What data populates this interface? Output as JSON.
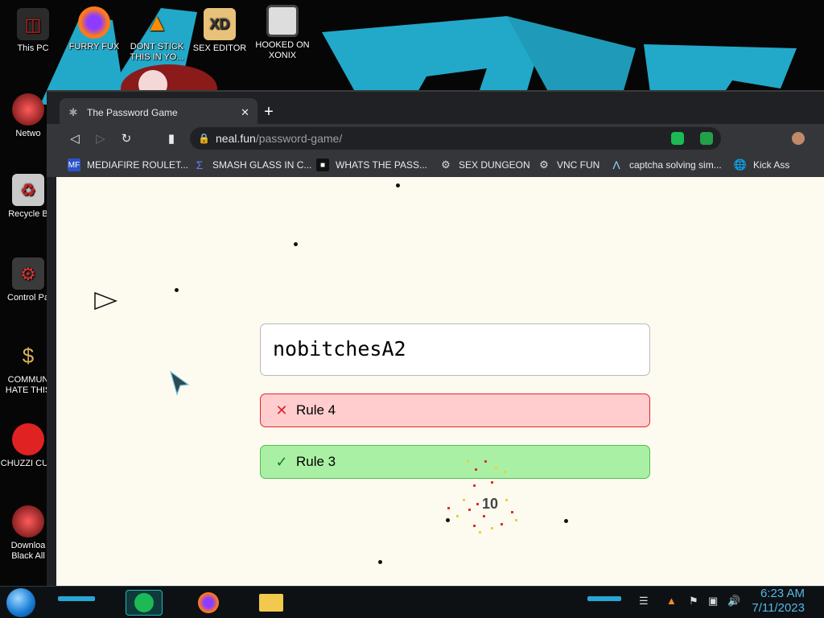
{
  "desktop": {
    "top_icons": [
      {
        "label": "This PC",
        "icon": "computer-icon"
      },
      {
        "label": "FURRY FUX",
        "icon": "firefox-icon"
      },
      {
        "label": "DONT STICK THIS IN YO...",
        "icon": "vlc-cone-icon"
      },
      {
        "label": "SEX EDITOR",
        "icon": "xd-editor-icon"
      },
      {
        "label": "HOOKED ON XONIX",
        "icon": "xonix-game-icon"
      }
    ],
    "left_icons": [
      {
        "label": "Netwo",
        "icon": "network-icon"
      },
      {
        "label": "Recycle B",
        "icon": "recycle-bin-icon"
      },
      {
        "label": "Control Pa",
        "icon": "control-panel-icon"
      },
      {
        "label": "COMMUN HATE THIS",
        "icon": "money-bag-icon"
      },
      {
        "label": "CHUZZI CUM",
        "icon": "chuzzle-icon"
      },
      {
        "label": "Downloa Black All",
        "icon": "download-icon"
      }
    ]
  },
  "browser": {
    "tab_title": "The Password Game",
    "url_host": "neal.fun",
    "url_path": "/password-game/",
    "bookmarks": [
      {
        "label": "MEDIAFIRE ROULET...",
        "icon": "mediafire-icon"
      },
      {
        "label": "SMASH GLASS IN C...",
        "icon": "sigma-icon"
      },
      {
        "label": "WHATS THE PASS...",
        "icon": "terminal-icon"
      },
      {
        "label": "SEX DUNGEON",
        "icon": "gamepad-icon"
      },
      {
        "label": "VNC FUN",
        "icon": "gamepad-icon"
      },
      {
        "label": "captcha solving sim...",
        "icon": "lambda-icon"
      },
      {
        "label": "Kick Ass",
        "icon": "globe-icon"
      }
    ]
  },
  "game": {
    "password": "nobitchesA2",
    "rules": [
      {
        "label": "Rule 4",
        "status": "fail"
      },
      {
        "label": "Rule 3",
        "status": "pass"
      }
    ],
    "counter": "10"
  },
  "taskbar": {
    "time": "6:23 AM",
    "date": "7/11/2023"
  },
  "colors": {
    "rule_fail_bg": "#ffcdcd",
    "rule_fail_border": "#e6252a",
    "rule_pass_bg": "#aaf0a4",
    "rule_pass_border": "#4fbf4a",
    "page_bg": "#fdfbf0",
    "wallpaper_accent": "#22a9c9"
  }
}
